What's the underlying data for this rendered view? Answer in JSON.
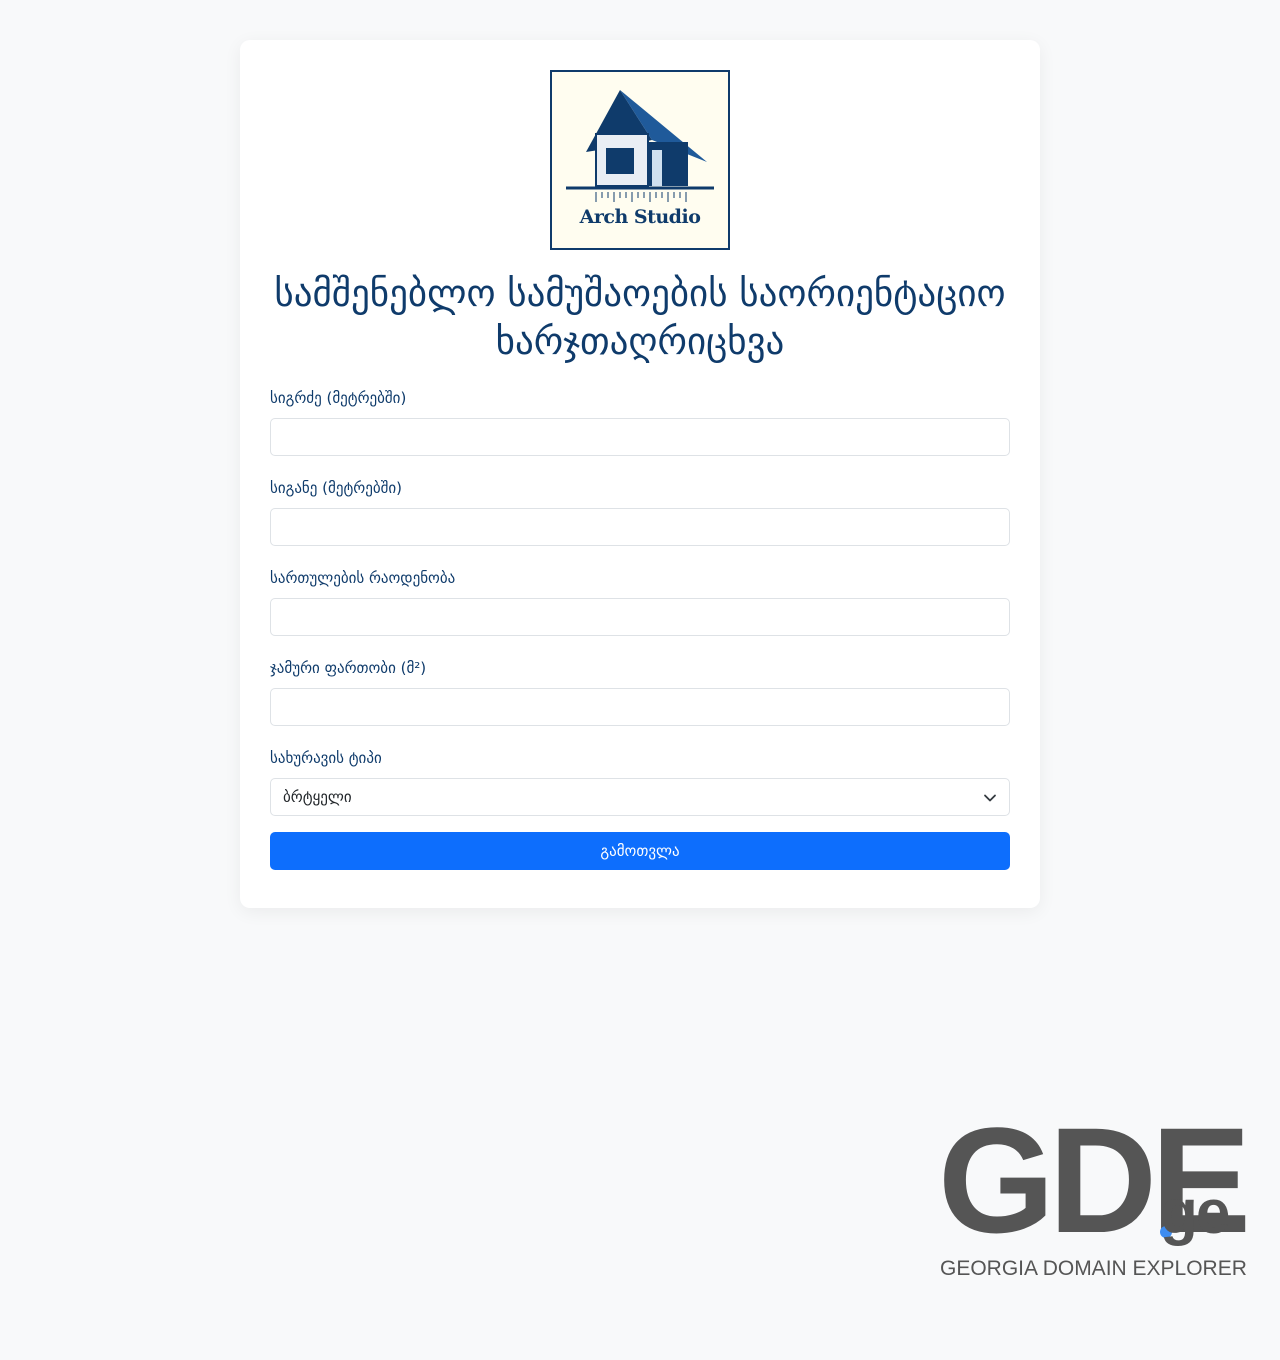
{
  "logo": {
    "text": "Arch Studio"
  },
  "title": "სამშენებლო სამუშაოების საორიენტაციო ხარჯთაღრიცხვა",
  "fields": [
    {
      "label": "სიგრძე (მეტრებში)",
      "value": ""
    },
    {
      "label": "სიგანე (მეტრებში)",
      "value": ""
    },
    {
      "label": "სართულების რაოდენობა",
      "value": ""
    },
    {
      "label": "ჯამური ფართობი (მ²)",
      "value": ""
    }
  ],
  "roof": {
    "label": "სახურავის ტიპი",
    "selected": "ბრტყელი"
  },
  "submit_label": "გამოთვლა",
  "footer_brand": {
    "letters": "GDE",
    "suffix": "ge",
    "tagline": "GEORGIA DOMAIN EXPLORER"
  },
  "colors": {
    "primary": "#0d6efd",
    "heading": "#0f3b6b",
    "background": "#f8f9fa"
  }
}
